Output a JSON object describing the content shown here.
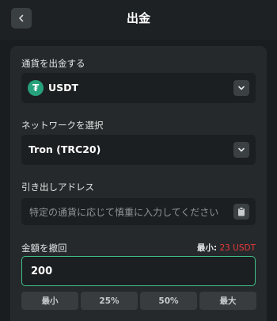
{
  "header": {
    "title": "出金",
    "back_icon": "chevron-left-icon"
  },
  "currency": {
    "label": "通貨を出金する",
    "selected": "USDT",
    "coin_icon": "tether-icon",
    "coin_symbol": "₮",
    "coin_color": "#26a17b"
  },
  "network": {
    "label": "ネットワークを選択",
    "selected": "Tron (TRC20)"
  },
  "address": {
    "label": "引き出しアドレス",
    "placeholder": "特定の通貨に応じて慎重に入力してください",
    "paste_icon": "clipboard-icon"
  },
  "amount": {
    "label": "金額を撤回",
    "min_label": "最小:",
    "min_value": "23 USDT",
    "value": "200",
    "accent_color": "#3fbf8a",
    "min_color": "#e5383b"
  },
  "quick_buttons": [
    "最小",
    "25%",
    "50%",
    "最大"
  ]
}
